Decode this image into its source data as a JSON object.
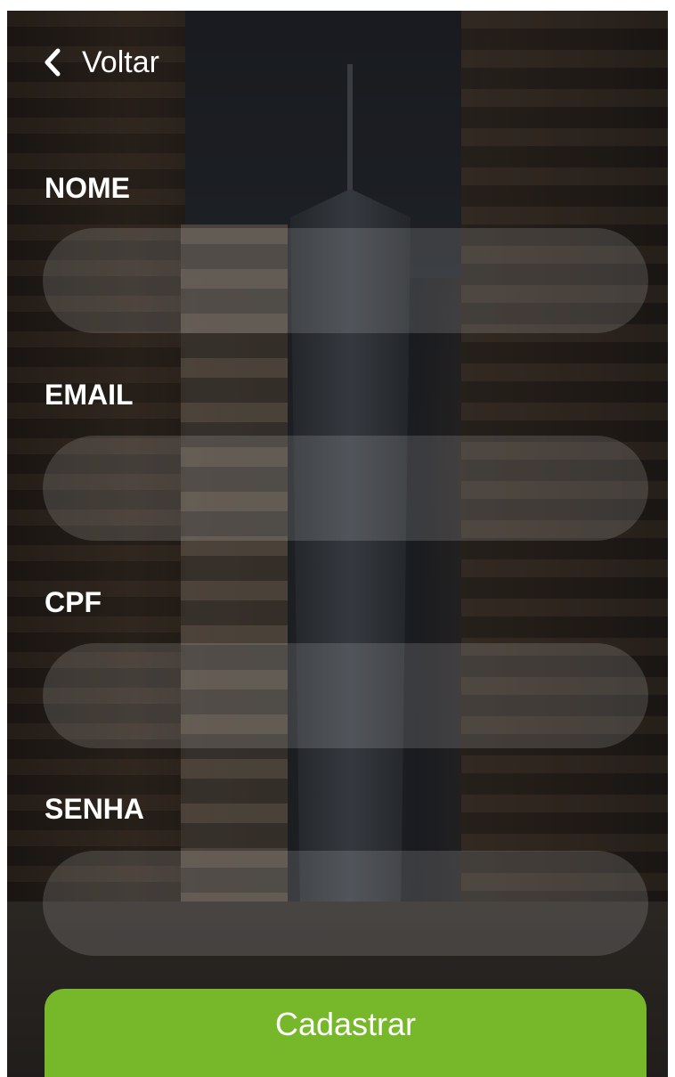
{
  "nav": {
    "back_label": "Voltar",
    "back_icon": "chevron-left-icon"
  },
  "form": {
    "fields": [
      {
        "label": "NOME",
        "value": "",
        "placeholder": ""
      },
      {
        "label": "EMAIL",
        "value": "",
        "placeholder": ""
      },
      {
        "label": "CPF",
        "value": "",
        "placeholder": ""
      },
      {
        "label": "SENHA",
        "value": "",
        "placeholder": ""
      }
    ],
    "submit_label": "Cadastrar"
  },
  "colors": {
    "accent": "#76b82a",
    "text": "#ffffff"
  }
}
